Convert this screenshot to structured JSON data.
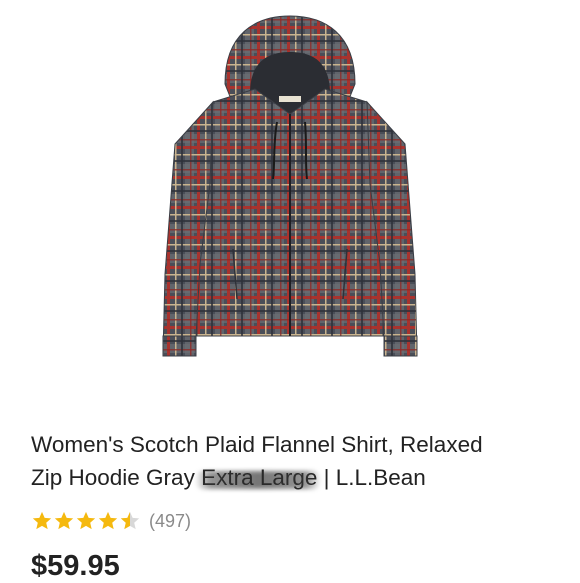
{
  "product": {
    "title_line1": "Women's Scotch Plaid Flannel Shirt, Relaxed",
    "title_line2_pre": "Zip Hoodie Gray ",
    "title_size": "Extra Large",
    "title_line2_post": " | L.L.Bean",
    "rating": 4.5,
    "rating_max": 5,
    "review_count": "(497)",
    "price": "$59.95",
    "image_icon": "plaid-hoodie-image"
  },
  "colors": {
    "star": "#F5B90F",
    "title": "#222222",
    "review": "#8A8A8A",
    "plaid_base": "#4A4E58",
    "plaid_red": "#A8332E"
  }
}
